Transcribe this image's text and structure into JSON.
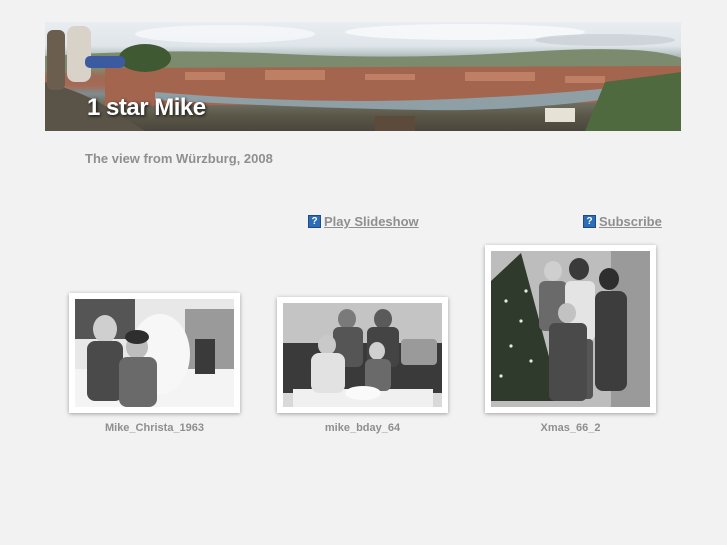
{
  "site": {
    "title": "1 star Mike",
    "caption": "The view from Würzburg, 2008"
  },
  "actions": {
    "slideshow": {
      "label": "Play Slideshow",
      "icon": "help-icon"
    },
    "subscribe": {
      "label": "Subscribe",
      "icon": "help-icon"
    }
  },
  "photos": [
    {
      "title": "Mike_Christa_1963"
    },
    {
      "title": "mike_bday_64"
    },
    {
      "title": "Xmas_66_2"
    }
  ],
  "colors": {
    "background": "#f2f2f2",
    "link_text": "#8f8f8f",
    "icon_blue": "#2e6db5"
  }
}
